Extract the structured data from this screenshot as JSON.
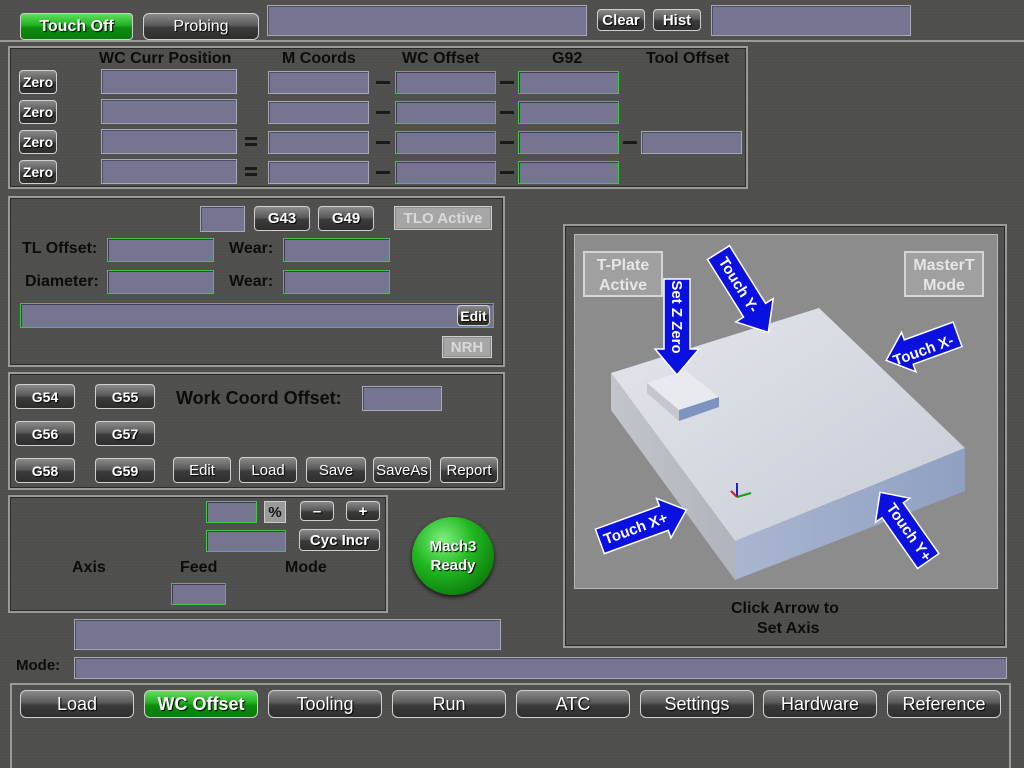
{
  "top": {
    "touch_off": "Touch Off",
    "probing": "Probing",
    "clear": "Clear",
    "hist": "Hist"
  },
  "coords": {
    "headers": {
      "wc_curr": "WC Curr Position",
      "m_coords": "M Coords",
      "wc_offset": "WC Offset",
      "g92": "G92",
      "tool_offset": "Tool Offset"
    },
    "zero_label": "Zero"
  },
  "tool": {
    "g43": "G43",
    "g49": "G49",
    "tlo_active": "TLO Active",
    "tl_offset": "TL Offset:",
    "wear1": "Wear:",
    "diameter": "Diameter:",
    "wear2": "Wear:",
    "edit": "Edit",
    "nrh": "NRH"
  },
  "wco": {
    "g54": "G54",
    "g55": "G55",
    "g56": "G56",
    "g57": "G57",
    "g58": "G58",
    "g59": "G59",
    "title": "Work Coord Offset:",
    "edit": "Edit",
    "load": "Load",
    "save": "Save",
    "saveas": "SaveAs",
    "report": "Report"
  },
  "cycle": {
    "percent": "%",
    "minus": "–",
    "plus": "+",
    "cyc_incr": "Cyc Incr",
    "axis": "Axis",
    "feed": "Feed",
    "mode": "Mode"
  },
  "status": {
    "line1": "Mach3",
    "line2": "Ready"
  },
  "viz": {
    "tplate_1": "T-Plate",
    "tplate_2": "Active",
    "mastert_1": "MasterT",
    "mastert_2": "Mode",
    "touch_y_minus": "Touch Y-",
    "set_z_zero": "Set Z Zero",
    "touch_x_minus": "Touch X-",
    "touch_x_plus": "Touch X+",
    "touch_y_plus": "Touch Y+",
    "caption_1": "Click Arrow to",
    "caption_2": "Set Axis"
  },
  "mode_label": "Mode:",
  "tabs": [
    "Load",
    "WC Offset",
    "Tooling",
    "Run",
    "ATC",
    "Settings",
    "Hardware",
    "Reference"
  ],
  "active_tab": "WC Offset",
  "colors": {
    "accent_green": "#22b022",
    "field_fill": "#757591",
    "arrow_blue": "#0a10e0"
  }
}
